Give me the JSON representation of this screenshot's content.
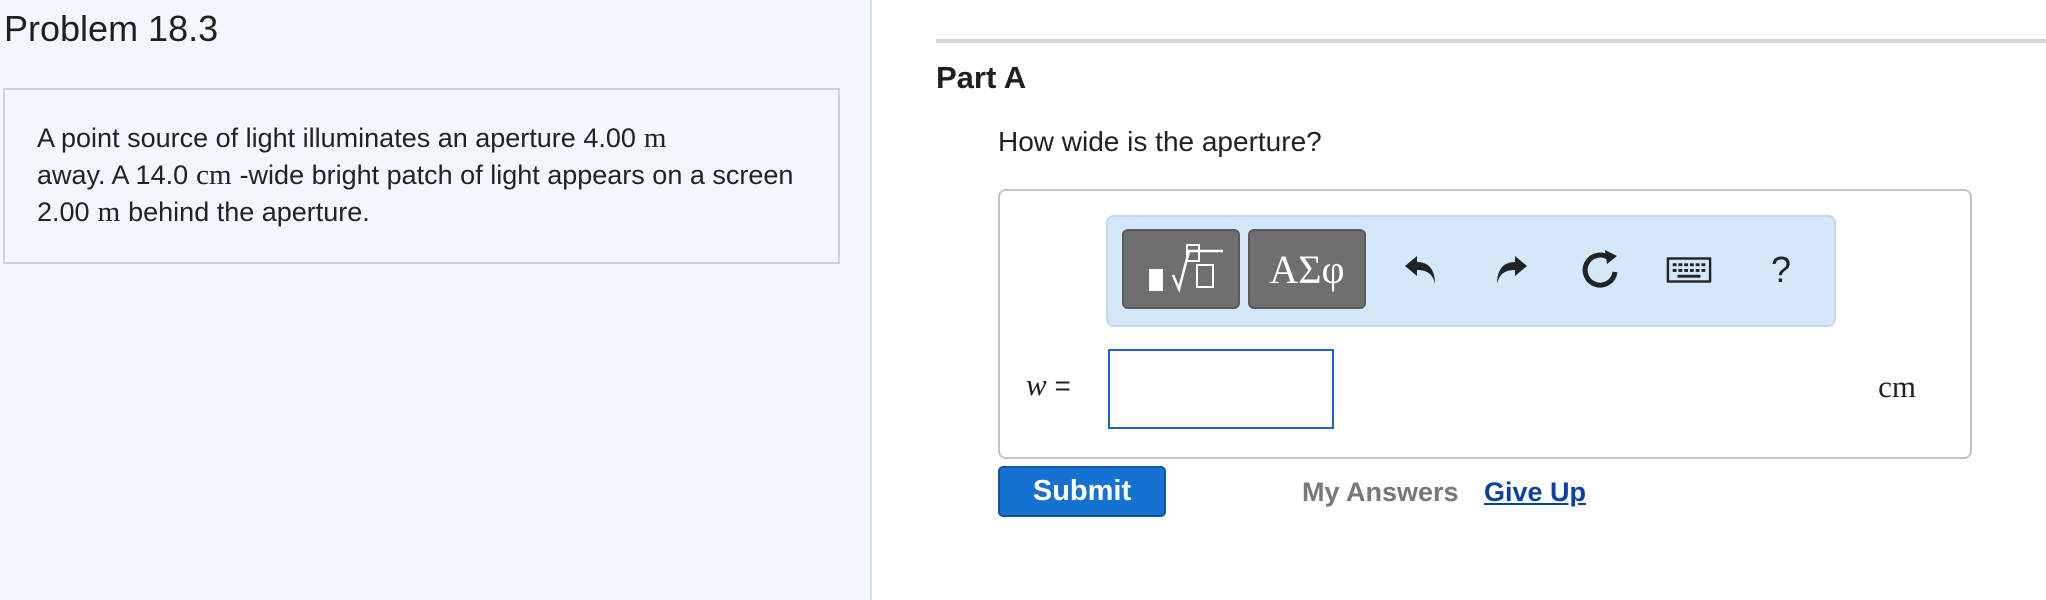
{
  "problem": {
    "title": "Problem 18.3",
    "text_parts": [
      "A point source of light illuminates an aperture 4.00",
      "m",
      "away. A 14.0",
      "cm",
      "-wide bright patch of light appears on a screen 2.00",
      "m",
      "behind the aperture."
    ]
  },
  "part": {
    "title": "Part A",
    "question": "How wide is the aperture?",
    "toolbar": {
      "templates_icon": "templates-sqrt-icon",
      "greek_label": "ΑΣφ",
      "undo_icon": "undo-icon",
      "redo_icon": "redo-icon",
      "reset_icon": "reset-icon",
      "keyboard_icon": "keyboard-icon",
      "help_label": "?"
    },
    "variable": "w",
    "equals": "=",
    "answer_value": "",
    "unit": "cm",
    "submit_label": "Submit",
    "my_answers_label": "My Answers",
    "give_up_label": "Give Up"
  },
  "colors": {
    "left_pane_bg": "#f2f7fd",
    "toolbar_bg": "#d5e8fb",
    "submit_bg": "#1771d0",
    "link": "#0a3fa6",
    "input_border": "#1a66c9"
  }
}
